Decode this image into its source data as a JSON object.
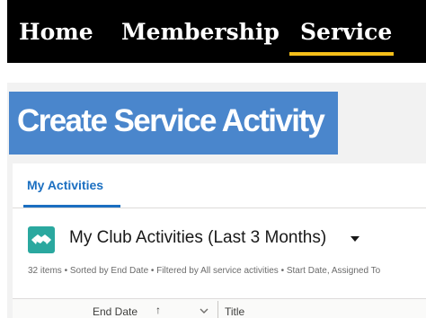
{
  "nav": {
    "items": [
      {
        "label": "Home"
      },
      {
        "label": "Membership"
      },
      {
        "label": "Service"
      }
    ],
    "active_item": "Service",
    "active_underline_color": "#f5bf1a"
  },
  "page": {
    "heading": "Create Service Activity",
    "heading_bg_color": "#4a86cc"
  },
  "tabs": {
    "active_label": "My Activities"
  },
  "list_view": {
    "icon": "activity-list-icon",
    "icon_color": "#2aa89f",
    "title": "My Club Activities (Last 3 Months)",
    "meta": "32 items • Sorted by End Date • Filtered by All service activities • Start Date, Assigned To",
    "columns": [
      {
        "label": "End Date",
        "sort_icon": "↑"
      },
      {
        "label": "Title"
      }
    ]
  }
}
